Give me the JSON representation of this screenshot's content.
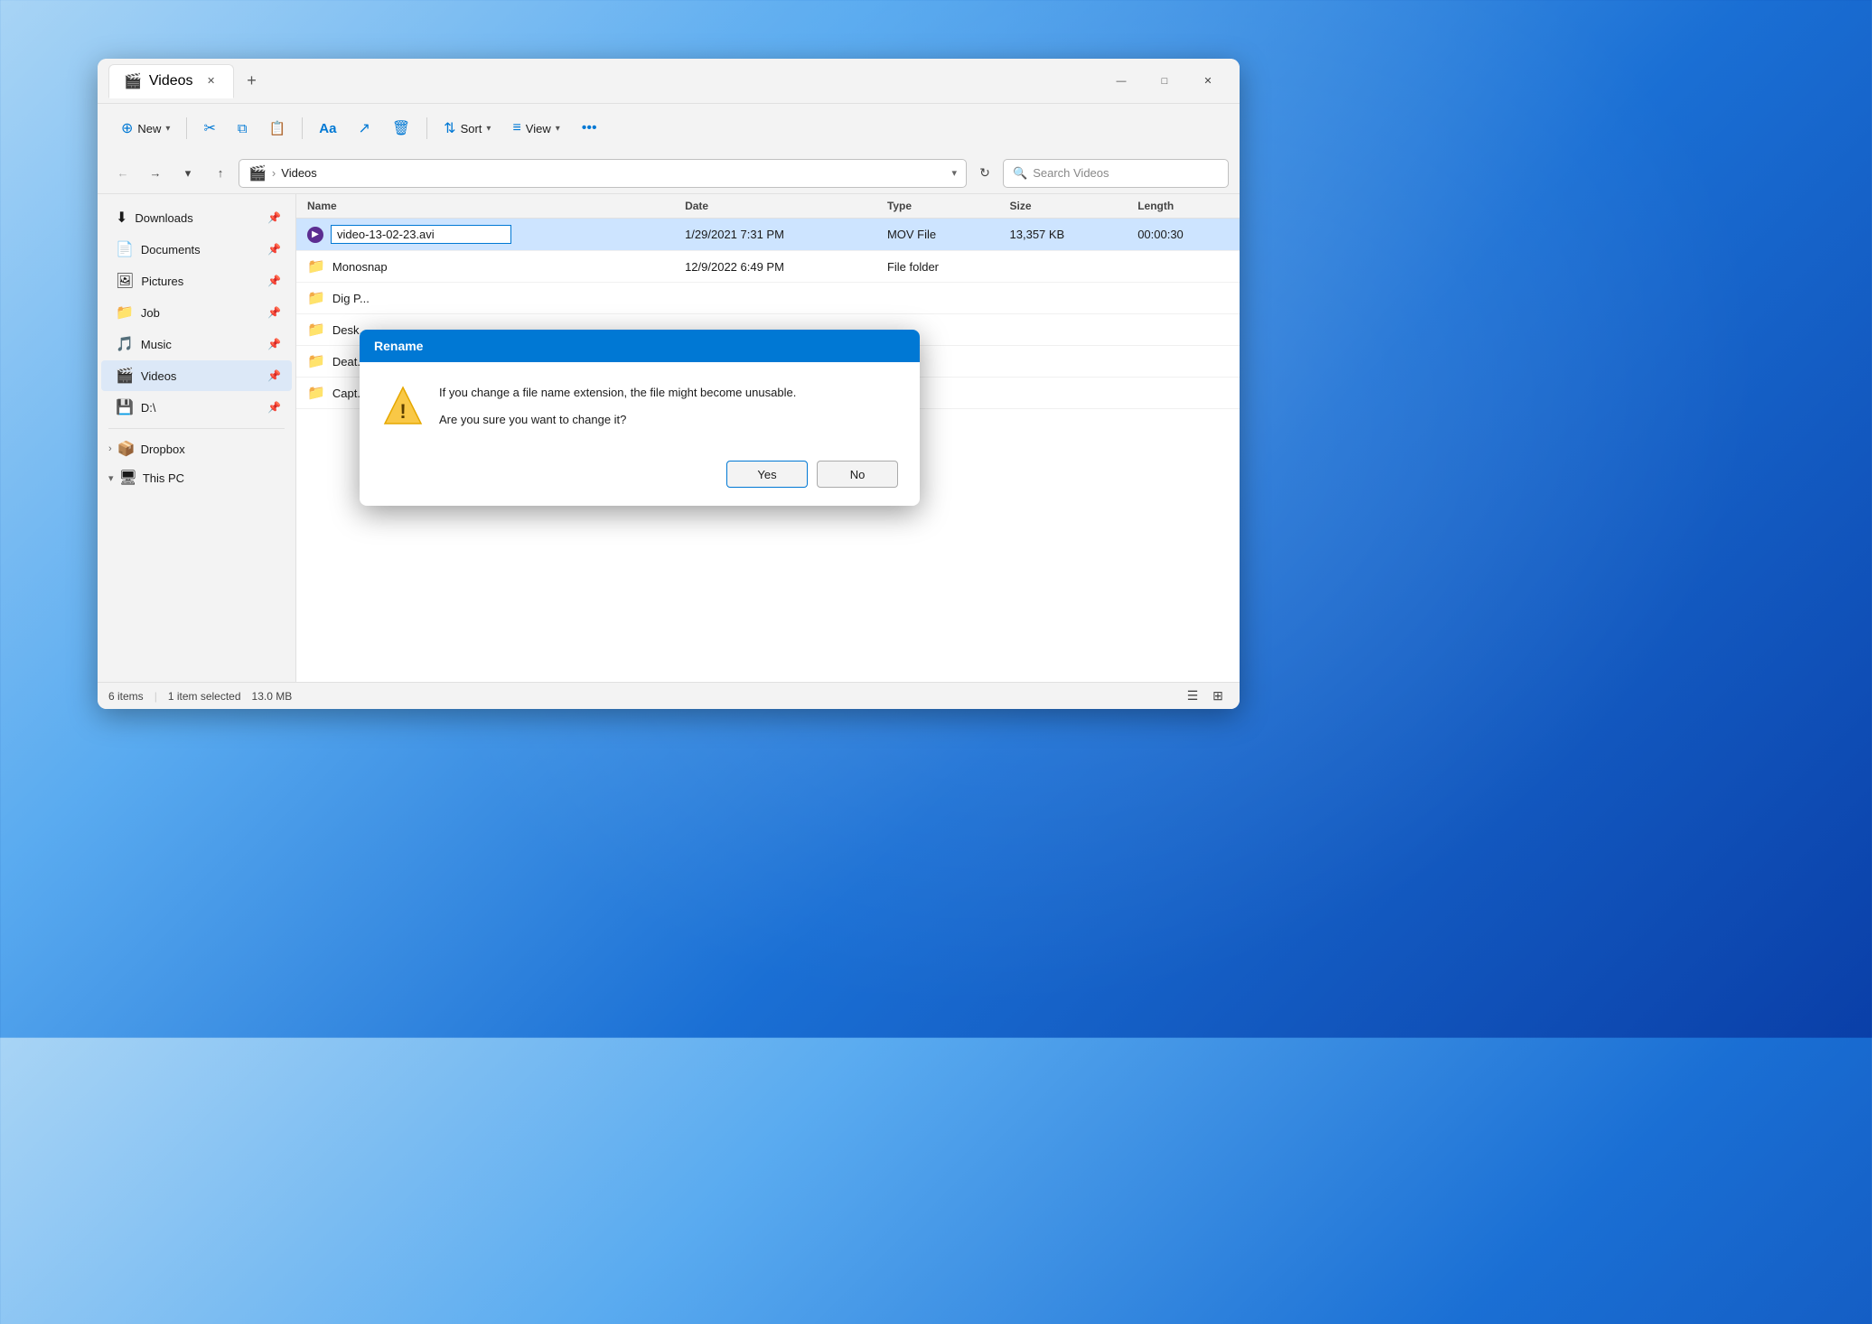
{
  "window": {
    "title": "Videos",
    "tab_icon": "🎬"
  },
  "titlebar": {
    "tab_label": "Videos",
    "new_tab_label": "+",
    "minimize": "—",
    "maximize": "□",
    "close": "✕"
  },
  "toolbar": {
    "new_label": "New",
    "new_icon": "⊕",
    "cut_icon": "✂",
    "copy_icon": "⧉",
    "paste_icon": "📋",
    "rename_icon": "Aa",
    "share_icon": "↗",
    "delete_icon": "🗑",
    "sort_label": "Sort",
    "sort_icon": "⇅",
    "view_label": "View",
    "view_icon": "≡",
    "more_icon": "•••"
  },
  "addressbar": {
    "path_icon": "🎬",
    "separator": ">",
    "path": "Videos",
    "search_placeholder": "Search Videos"
  },
  "sidebar": {
    "items": [
      {
        "id": "downloads",
        "label": "Downloads",
        "icon": "⬇",
        "pinned": true
      },
      {
        "id": "documents",
        "label": "Documents",
        "icon": "📄",
        "pinned": true
      },
      {
        "id": "pictures",
        "label": "Pictures",
        "icon": "🖼",
        "pinned": true
      },
      {
        "id": "job",
        "label": "Job",
        "icon": "📁",
        "pinned": true
      },
      {
        "id": "music",
        "label": "Music",
        "icon": "🎵",
        "pinned": true
      },
      {
        "id": "videos",
        "label": "Videos",
        "icon": "🎬",
        "pinned": true,
        "active": true
      },
      {
        "id": "d-drive",
        "label": "D:\\",
        "icon": "💾",
        "pinned": true
      }
    ],
    "sections": [
      {
        "id": "dropbox",
        "label": "Dropbox",
        "icon": "📦",
        "collapsed": true
      },
      {
        "id": "this-pc",
        "label": "This PC",
        "icon": "🖥",
        "collapsed": false
      }
    ]
  },
  "columns": {
    "name": "Name",
    "date": "Date",
    "type": "Type",
    "size": "Size",
    "length": "Length"
  },
  "files": [
    {
      "id": 1,
      "name": "video-13-02-23.avi",
      "editing": true,
      "icon": "🎥",
      "date": "1/29/2021 7:31 PM",
      "type": "MOV File",
      "size": "13,357 KB",
      "length": "00:00:30",
      "selected": true
    },
    {
      "id": 2,
      "name": "Monosnap",
      "editing": false,
      "icon": "📁",
      "date": "12/9/2022 6:49 PM",
      "type": "File folder",
      "size": "",
      "length": "",
      "selected": false
    },
    {
      "id": 3,
      "name": "Dig P...",
      "editing": false,
      "icon": "📁",
      "date": "",
      "type": "",
      "size": "",
      "length": "",
      "selected": false
    },
    {
      "id": 4,
      "name": "Desk...",
      "editing": false,
      "icon": "📁",
      "date": "",
      "type": "",
      "size": "",
      "length": "",
      "selected": false
    },
    {
      "id": 5,
      "name": "Deat...",
      "editing": false,
      "icon": "📁",
      "date": "",
      "type": "",
      "size": "",
      "length": "",
      "selected": false
    },
    {
      "id": 6,
      "name": "Capt...",
      "editing": false,
      "icon": "📁",
      "date": "",
      "type": "",
      "size": "",
      "length": "",
      "selected": false
    }
  ],
  "statusbar": {
    "item_count": "6 items",
    "selected": "1 item selected",
    "size": "13.0 MB"
  },
  "dialog": {
    "title": "Rename",
    "message": "If you change a file name extension, the file might become unusable.",
    "question": "Are you sure you want to change it?",
    "yes_label": "Yes",
    "no_label": "No"
  }
}
